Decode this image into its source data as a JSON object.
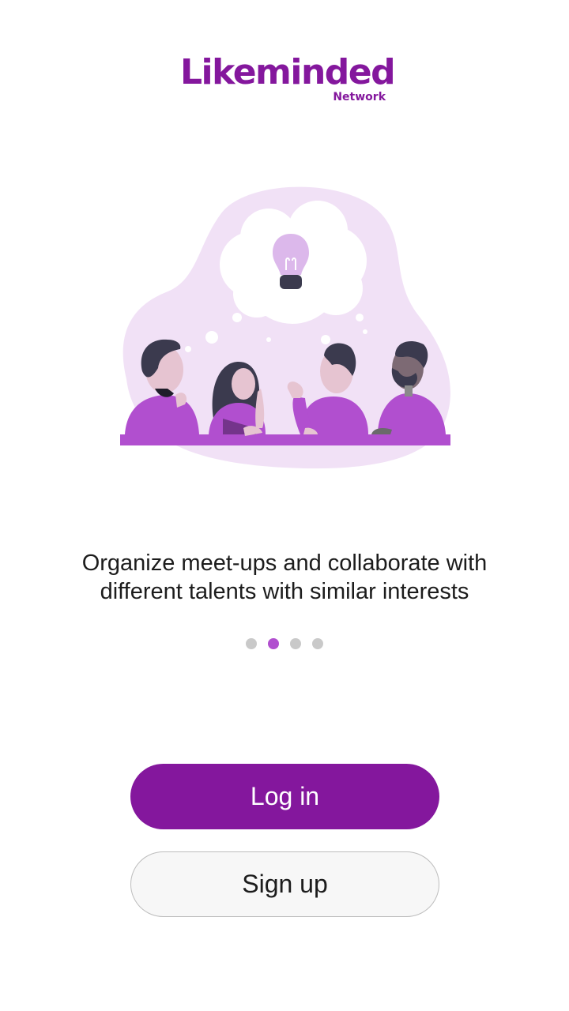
{
  "brand": {
    "title": "Likeminded",
    "subtitle": "Network"
  },
  "onboarding": {
    "tagline_line1": "Organize meet-ups and collaborate with",
    "tagline_line2": "different talents with similar interests",
    "pages_total": 4,
    "current_page": 2
  },
  "actions": {
    "login_label": "Log in",
    "signup_label": "Sign up"
  },
  "colors": {
    "brand": "#84179d",
    "accent": "#b14fcf",
    "illustration_bg": "#f1e1f6",
    "shirt": "#b14fcf",
    "hair": "#3b3a4e",
    "skin": "#e6c4d1",
    "bulb": "#dcb8eb"
  },
  "icons": {
    "illustration": "team-idea-illustration",
    "bulb": "lightbulb-icon"
  }
}
